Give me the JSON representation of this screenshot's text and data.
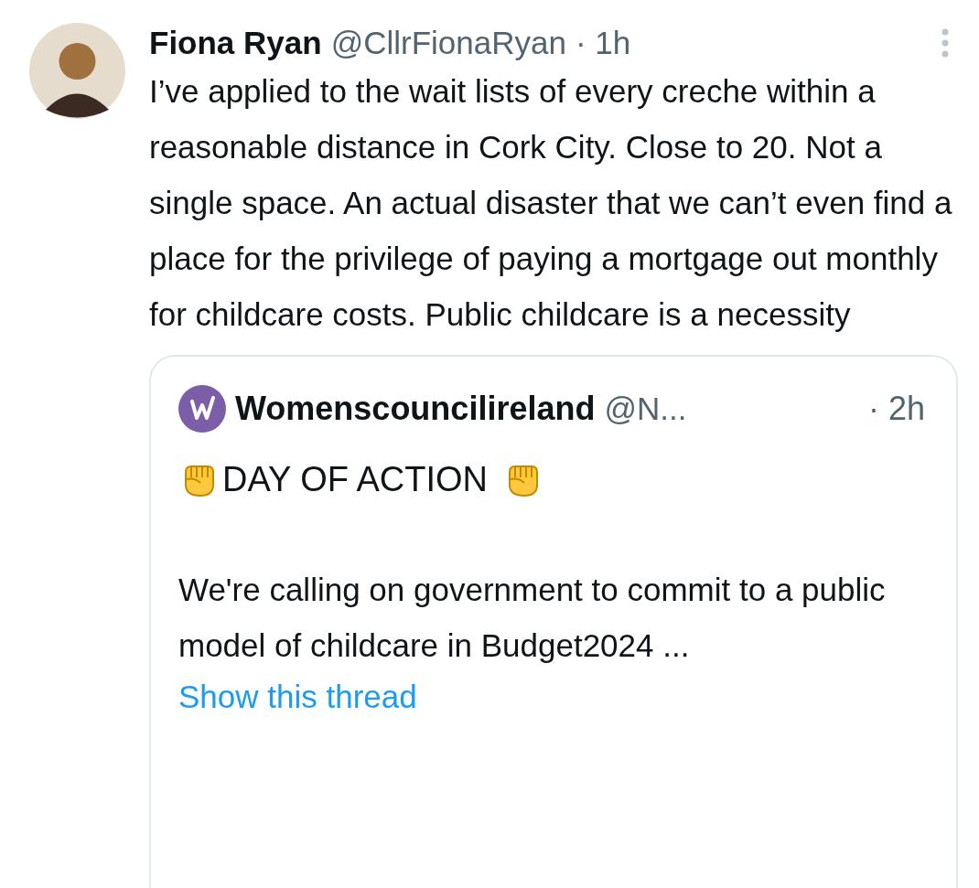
{
  "tweet": {
    "author": "Fiona Ryan",
    "handle": "@CllrFionaRyan",
    "time": "· 1h",
    "text": "I’ve applied to the wait lists of every creche within a reasonable distance in Cork City. Close to 20. Not a single space. An actual disaster that we can’t even find a place for the privilege of paying a mortgage out monthly for childcare costs. Public childcare is a necessity",
    "quote": {
      "author": "Womenscouncilireland",
      "handle": "@N...",
      "time": "· 2h",
      "headline": "DAY OF ACTION",
      "text": "We're calling on government to commit to a public model of childcare in Budget2024 ...",
      "link": "Show this thread"
    }
  }
}
